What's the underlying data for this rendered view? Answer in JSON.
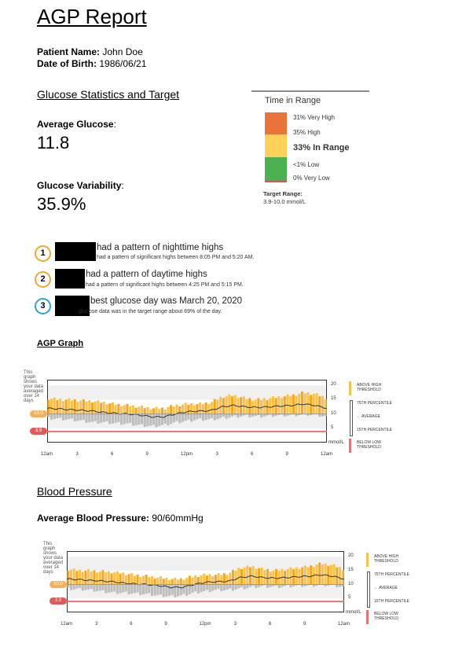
{
  "title": "AGP Report",
  "patient": {
    "name_label": "Patient Name",
    "name": "John Doe",
    "dob_label": "Date of Birth",
    "dob": "1986/06/21"
  },
  "stats_heading": "Glucose Statistics and Target",
  "avg_glucose": {
    "label": "Average Glucose",
    "value": "11.8"
  },
  "variability": {
    "label": "Glucose Variability",
    "value": "35.9%"
  },
  "tir": {
    "title": "Time in Range",
    "very_high": "31% Very High",
    "high": "35% High",
    "in_range": "33% In Range",
    "low": "<1% Low",
    "very_low": "0% Very Low",
    "target_label": "Target Range:",
    "target_value": "3.9-10.0 mmol/L",
    "colors": {
      "very_high": "#e8743b",
      "high": "#e8743b",
      "in_range": "#fdd25b",
      "low": "#4caf50",
      "very_low": "#d9534f"
    }
  },
  "patterns": [
    {
      "num": "1",
      "color": "#f0a830",
      "main": "had a pattern of nighttime highs",
      "sub": "had a pattern of significant highs between 8:05 PM and 5:20 AM."
    },
    {
      "num": "2",
      "color": "#f0a830",
      "main": "had a pattern of daytime highs",
      "sub": "had a pattern of significant highs between 4:25 PM and 5:15 PM."
    },
    {
      "num": "3",
      "color": "#2ba5d6",
      "main": "best glucose day was March 20, 2020",
      "sub": "glucose data was in the target range about 69% of the day."
    }
  ],
  "agp_heading": "AGP Graph",
  "graph": {
    "caption": "This graph shows your data averaged over 14 days",
    "x_ticks": [
      "12am",
      "3",
      "6",
      "9",
      "12pm",
      "3",
      "6",
      "9",
      "12am"
    ],
    "y_ticks": [
      "20",
      "15",
      "10",
      "5"
    ],
    "unit": "mmol/L",
    "high_pill": "10.0",
    "low_pill": "3.9",
    "legend": {
      "above_high": "ABOVE HIGH THRESHOLD",
      "p75": "75TH PERCENTILE",
      "average": "AVERAGE",
      "p15": "15TH PERCENTILE",
      "below_low": "BELOW LOW THRESHOLD"
    }
  },
  "bp_heading": "Blood Pressure",
  "bp": {
    "label": "Average Blood Pressure",
    "value": "90/60mmHg"
  },
  "chart_data": [
    {
      "type": "area",
      "title": "",
      "xlabel": "",
      "ylabel": "mmol/L",
      "x": [
        "12am",
        "1",
        "2",
        "3",
        "4",
        "5",
        "6",
        "7",
        "8",
        "9",
        "10",
        "11",
        "12pm",
        "1",
        "2",
        "3",
        "4",
        "5",
        "6",
        "7",
        "8",
        "9",
        "10",
        "11",
        "12am"
      ],
      "ylim": [
        0,
        22
      ],
      "series": [
        {
          "name": "75TH PERCENTILE",
          "values": [
            15,
            14.6,
            14.5,
            14.2,
            14,
            13.5,
            12.8,
            12.5,
            12,
            11.5,
            11.5,
            12.5,
            13,
            13,
            13.5,
            15.5,
            16,
            15,
            14.5,
            15,
            15.5,
            16,
            17,
            16.5,
            15
          ]
        },
        {
          "name": "AVERAGE",
          "values": [
            12,
            11.8,
            11.5,
            11.3,
            11,
            10.5,
            10.2,
            10,
            9.6,
            9,
            9,
            10,
            10.8,
            11,
            11.2,
            12.5,
            13,
            12.5,
            12.3,
            12.5,
            12.8,
            13,
            13.5,
            13,
            12
          ]
        },
        {
          "name": "15TH PERCENTILE",
          "values": [
            9,
            8.8,
            8.5,
            8,
            7.5,
            7.5,
            7.2,
            7,
            6.5,
            6.2,
            6.5,
            7.5,
            8,
            8.5,
            8.5,
            9,
            9.5,
            9.8,
            9.6,
            9.8,
            10,
            10,
            10.3,
            10.2,
            9.5
          ]
        }
      ]
    }
  ]
}
